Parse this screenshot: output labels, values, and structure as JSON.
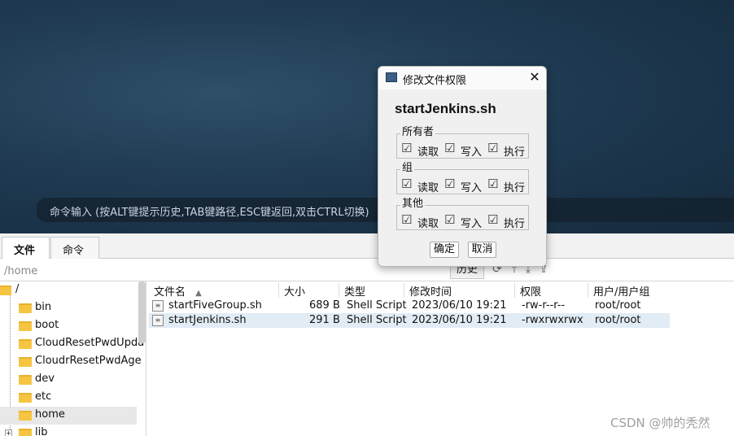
{
  "terminal": {
    "command_hint": "命令输入 (按ALT键提示历史,TAB键路径,ESC键返回,双击CTRL切换)"
  },
  "tabs": [
    {
      "label": "文件"
    },
    {
      "label": "命令"
    }
  ],
  "path_bar": {
    "path": "/home",
    "history_label": "历史"
  },
  "tree": {
    "root": "/",
    "items": [
      {
        "label": "bin"
      },
      {
        "label": "boot"
      },
      {
        "label": "CloudResetPwdUpda"
      },
      {
        "label": "CloudrResetPwdAge"
      },
      {
        "label": "dev"
      },
      {
        "label": "etc"
      },
      {
        "label": "home"
      },
      {
        "label": "lib"
      }
    ]
  },
  "file_list": {
    "columns": [
      "文件名",
      "大小",
      "类型",
      "修改时间",
      "权限",
      "用户/用户组"
    ],
    "sort_indicator": "▲",
    "rows": [
      {
        "name": "startFiveGroup.sh",
        "size": "689 B",
        "type": "Shell Script",
        "modified": "2023/06/10 19:21",
        "permissions": "-rw-r--r--",
        "owner": "root/root"
      },
      {
        "name": "startJenkins.sh",
        "size": "291 B",
        "type": "Shell Script",
        "modified": "2023/06/10 19:21",
        "permissions": "-rwxrwxrwx",
        "owner": "root/root"
      }
    ]
  },
  "dialog": {
    "title": "修改文件权限",
    "filename": "startJenkins.sh",
    "groups": [
      {
        "name": "所有者",
        "read": "读取",
        "write": "写入",
        "execute": "执行"
      },
      {
        "name": "组",
        "read": "读取",
        "write": "写入",
        "execute": "执行"
      },
      {
        "name": "其他",
        "read": "读取",
        "write": "写入",
        "execute": "执行"
      }
    ],
    "ok_label": "确定",
    "cancel_label": "取消"
  },
  "watermark": "CSDN @帅的秃然"
}
